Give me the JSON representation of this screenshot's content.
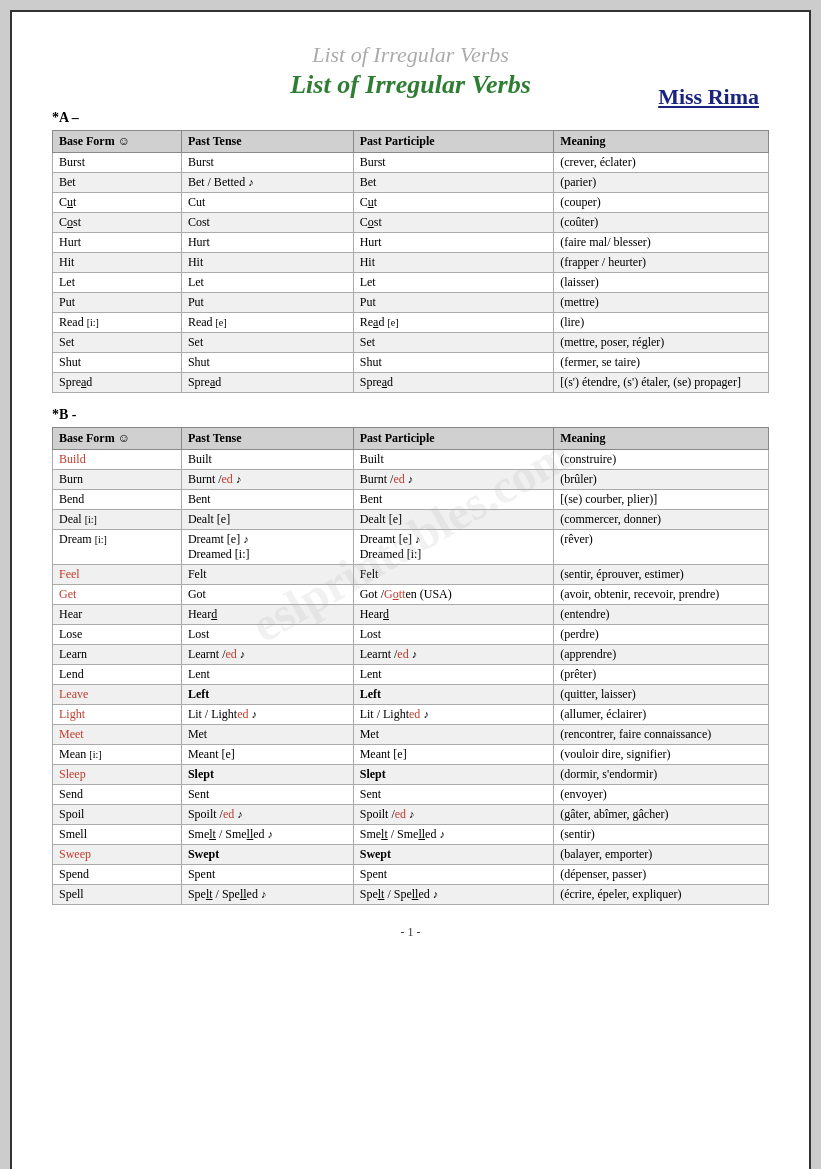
{
  "page": {
    "title_faded": "List of Irregular Verbs",
    "title_main": "List of Irregular Verbs",
    "author": "Miss Rima",
    "watermark": "eslprintables.com",
    "page_number": "- 1 -",
    "section_a_label": "*A –",
    "section_b_label": "*B -",
    "table_headers": [
      "Base Form ☺",
      "Past Tense",
      "Past Participle",
      "Meaning"
    ],
    "section_a_rows": [
      {
        "base": "Burst",
        "past": "Burst",
        "participle": "Burst",
        "meaning": "(crever, éclater)"
      },
      {
        "base": "Bet",
        "past": "Bet / Betted ♪",
        "participle": "Bet",
        "meaning": "(parier)"
      },
      {
        "base": "Cut",
        "past": "Cut",
        "participle": "Cut",
        "meaning": "(couper)",
        "base_style": "underline_t"
      },
      {
        "base": "Cost",
        "past": "Cost",
        "participle": "Cost",
        "meaning": "(coûter)",
        "base_style": "underline_o"
      },
      {
        "base": "Hurt",
        "past": "Hurt",
        "participle": "Hurt",
        "meaning": "(faire mal/ blesser)"
      },
      {
        "base": "Hit",
        "past": "Hit",
        "participle": "Hit",
        "meaning": "(frapper / heurter)"
      },
      {
        "base": "Let",
        "past": "Let",
        "participle": "Let",
        "meaning": "(laisser)"
      },
      {
        "base": "Put",
        "past": "Put",
        "participle": "Put",
        "meaning": "(mettre)"
      },
      {
        "base": "Read [i:]",
        "past": "Read  [e]",
        "participle": "Read  [e]",
        "meaning": "(lire)"
      },
      {
        "base": "Set",
        "past": "Set",
        "participle": "Set",
        "meaning": "(mettre, poser, régler)"
      },
      {
        "base": "Shut",
        "past": "Shut",
        "participle": "Shut",
        "meaning": "(fermer, se taire)"
      },
      {
        "base": "Spread",
        "past": "Spread",
        "participle": "Spread",
        "meaning": "[(s') étendre, (s') étaler, (se) propager]"
      }
    ],
    "section_b_rows": [
      {
        "base": "Build",
        "past": "Built",
        "participle": "Built",
        "meaning": "(construire)",
        "base_color": "red"
      },
      {
        "base": "Burn",
        "past": "Burnt /ed ♪",
        "participle": "Burnt /ed  ♪",
        "meaning": "(brûler)"
      },
      {
        "base": "Bend",
        "past": "Bent",
        "participle": "Bent",
        "meaning": "[(se) courber, plier)]"
      },
      {
        "base": "Deal [i:]",
        "past": "Dealt  [e]",
        "participle": "Dealt [e]",
        "meaning": "(commercer, donner)"
      },
      {
        "base": "Dream [i:]",
        "past": "Dreamt  [e] ♪\nDreamed [i:]",
        "participle": "Dreamt [e]  ♪\nDreamed [i:]",
        "meaning": "(rêver)"
      },
      {
        "base": "Feel",
        "past": "Felt",
        "participle": "Felt",
        "meaning": "(sentir, éprouver, estimer)",
        "base_color": "red"
      },
      {
        "base": "Get",
        "past": "Got",
        "participle": "Got /Gotten (USA)",
        "meaning": "(avoir, obtenir, recevoir, prendre)",
        "base_color": "red"
      },
      {
        "base": "Hear",
        "past": "Heard",
        "participle": "Heard",
        "meaning": "(entendre)"
      },
      {
        "base": "Lose",
        "past": "Lost",
        "participle": "Lost",
        "meaning": "(perdre)"
      },
      {
        "base": "Learn",
        "past": "Learnt /ed  ♪",
        "participle": "Learnt /ed  ♪",
        "meaning": "(apprendre)"
      },
      {
        "base": "Lend",
        "past": "Lent",
        "participle": "Lent",
        "meaning": "(prêter)"
      },
      {
        "base": "Leave",
        "past": "Left",
        "participle": "Left",
        "meaning": "(quitter, laisser)",
        "base_color": "red"
      },
      {
        "base": "Light",
        "past": "Lit / Lighted ♪",
        "participle": "Lit / Lighted  ♪",
        "meaning": "(allumer, éclairer)",
        "base_color": "red"
      },
      {
        "base": "Meet",
        "past": "Met",
        "participle": "Met",
        "meaning": "(rencontrer, faire connaissance)",
        "base_color": "red"
      },
      {
        "base": "Mean [i:]",
        "past": "Meant  [e]",
        "participle": "Meant [e]",
        "meaning": "(vouloir dire, signifier)"
      },
      {
        "base": "Sleep",
        "past": "Slept",
        "participle": "Slept",
        "meaning": "(dormir, s'endormir)",
        "base_color": "red"
      },
      {
        "base": "Send",
        "past": "Sent",
        "participle": "Sent",
        "meaning": "(envoyer)"
      },
      {
        "base": "Spoil",
        "past": "Spoilt /ed  ♪",
        "participle": "Spoilt /ed  ♪",
        "meaning": "(gâter, abîmer, gâcher)"
      },
      {
        "base": "Smell",
        "past": "Smelt / Smelled ♪",
        "participle": "Smelt / Smelled ♪",
        "meaning": "(sentir)"
      },
      {
        "base": "Sweep",
        "past": "Swept",
        "participle": "Swept",
        "meaning": "(balayer, emporter)",
        "base_color": "red"
      },
      {
        "base": "Spend",
        "past": "Spent",
        "participle": "Spent",
        "meaning": "(dépenser, passer)"
      },
      {
        "base": "Spell",
        "past": "Spelt / Spelled  ♪",
        "participle": "Spelt / Spelled   ♪",
        "meaning": "(écrire, épeler, expliquer)"
      }
    ]
  }
}
